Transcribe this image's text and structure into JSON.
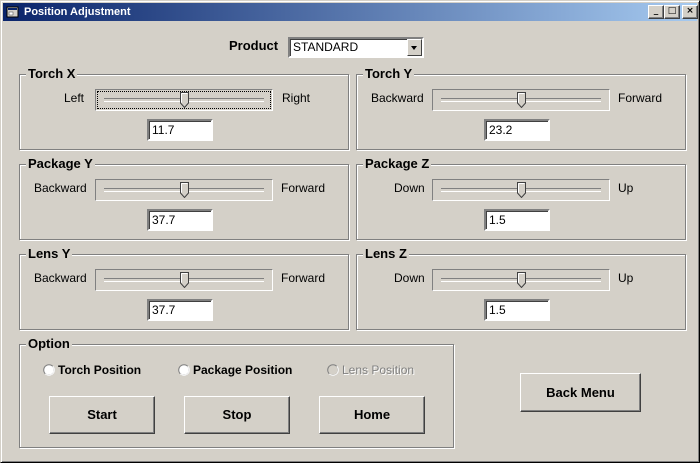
{
  "window": {
    "title": "Position Adjustment",
    "minimize_glyph": "_",
    "maximize_glyph": "□",
    "close_glyph": "×"
  },
  "product": {
    "label": "Product",
    "selected": "STANDARD"
  },
  "groups": {
    "torch_x": {
      "title": "Torch X",
      "left_label": "Left",
      "right_label": "Right",
      "value": "11.7",
      "slider_fraction": 0.5
    },
    "torch_y": {
      "title": "Torch Y",
      "left_label": "Backward",
      "right_label": "Forward",
      "value": "23.2",
      "slider_fraction": 0.5
    },
    "package_y": {
      "title": "Package Y",
      "left_label": "Backward",
      "right_label": "Forward",
      "value": "37.7",
      "slider_fraction": 0.5
    },
    "package_z": {
      "title": "Package Z",
      "left_label": "Down",
      "right_label": "Up",
      "value": "1.5",
      "slider_fraction": 0.5
    },
    "lens_y": {
      "title": "Lens Y",
      "left_label": "Backward",
      "right_label": "Forward",
      "value": "37.7",
      "slider_fraction": 0.5
    },
    "lens_z": {
      "title": "Lens Z",
      "left_label": "Down",
      "right_label": "Up",
      "value": "1.5",
      "slider_fraction": 0.5
    }
  },
  "option": {
    "title": "Option",
    "radios": [
      {
        "label": "Torch Position",
        "enabled": true
      },
      {
        "label": "Package Position",
        "enabled": true
      },
      {
        "label": "Lens Position",
        "enabled": false
      }
    ],
    "start_label": "Start",
    "stop_label": "Stop",
    "home_label": "Home"
  },
  "back_menu_label": "Back Menu"
}
